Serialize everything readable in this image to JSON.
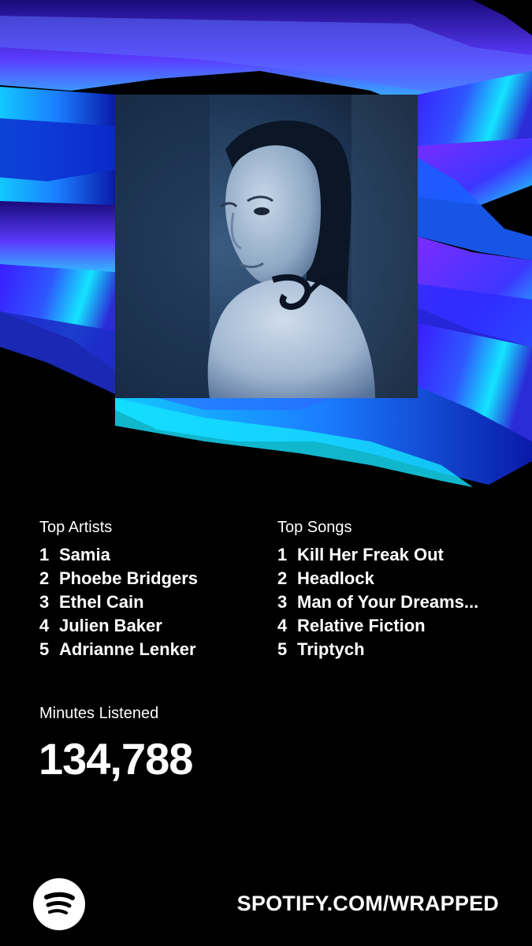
{
  "colors": {
    "background": "#000000",
    "accent_blue": "#2f57ff",
    "accent_cyan": "#14e4ff",
    "accent_purple": "#7b2cff",
    "text": "#ffffff"
  },
  "cover": {
    "icon": "portrait-photo"
  },
  "top_artists": {
    "heading": "Top Artists",
    "items": [
      {
        "rank": "1",
        "name": "Samia"
      },
      {
        "rank": "2",
        "name": "Phoebe Bridgers"
      },
      {
        "rank": "3",
        "name": "Ethel Cain"
      },
      {
        "rank": "4",
        "name": "Julien Baker"
      },
      {
        "rank": "5",
        "name": "Adrianne Lenker"
      }
    ]
  },
  "top_songs": {
    "heading": "Top Songs",
    "items": [
      {
        "rank": "1",
        "name": "Kill Her Freak Out"
      },
      {
        "rank": "2",
        "name": "Headlock"
      },
      {
        "rank": "3",
        "name": "Man of Your Dreams..."
      },
      {
        "rank": "4",
        "name": "Relative Fiction"
      },
      {
        "rank": "5",
        "name": "Triptych"
      }
    ]
  },
  "minutes": {
    "label": "Minutes Listened",
    "value": "134,788"
  },
  "footer": {
    "logo_icon": "spotify-logo-icon",
    "url": "SPOTIFY.COM/WRAPPED"
  }
}
